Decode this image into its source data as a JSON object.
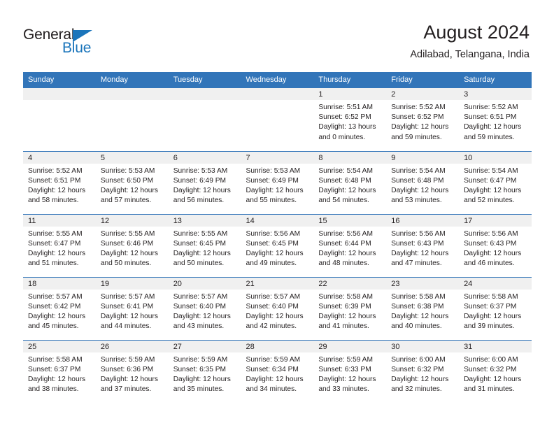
{
  "logo": {
    "text_top": "General",
    "text_bottom": "Blue",
    "accent_color": "#1b75bb"
  },
  "header": {
    "title": "August 2024",
    "subtitle": "Adilabad, Telangana, India"
  },
  "theme": {
    "header_blue": "#3275b9",
    "band_gray": "#f0f0f0",
    "text_dark": "#231f20"
  },
  "weekday_headers": [
    "Sunday",
    "Monday",
    "Tuesday",
    "Wednesday",
    "Thursday",
    "Friday",
    "Saturday"
  ],
  "weeks": [
    [
      {
        "blank": true
      },
      {
        "blank": true
      },
      {
        "blank": true
      },
      {
        "blank": true
      },
      {
        "day": "1",
        "sunrise": "Sunrise: 5:51 AM",
        "sunset": "Sunset: 6:52 PM",
        "daylight": "Daylight: 13 hours and 0 minutes."
      },
      {
        "day": "2",
        "sunrise": "Sunrise: 5:52 AM",
        "sunset": "Sunset: 6:52 PM",
        "daylight": "Daylight: 12 hours and 59 minutes."
      },
      {
        "day": "3",
        "sunrise": "Sunrise: 5:52 AM",
        "sunset": "Sunset: 6:51 PM",
        "daylight": "Daylight: 12 hours and 59 minutes."
      }
    ],
    [
      {
        "day": "4",
        "sunrise": "Sunrise: 5:52 AM",
        "sunset": "Sunset: 6:51 PM",
        "daylight": "Daylight: 12 hours and 58 minutes."
      },
      {
        "day": "5",
        "sunrise": "Sunrise: 5:53 AM",
        "sunset": "Sunset: 6:50 PM",
        "daylight": "Daylight: 12 hours and 57 minutes."
      },
      {
        "day": "6",
        "sunrise": "Sunrise: 5:53 AM",
        "sunset": "Sunset: 6:49 PM",
        "daylight": "Daylight: 12 hours and 56 minutes."
      },
      {
        "day": "7",
        "sunrise": "Sunrise: 5:53 AM",
        "sunset": "Sunset: 6:49 PM",
        "daylight": "Daylight: 12 hours and 55 minutes."
      },
      {
        "day": "8",
        "sunrise": "Sunrise: 5:54 AM",
        "sunset": "Sunset: 6:48 PM",
        "daylight": "Daylight: 12 hours and 54 minutes."
      },
      {
        "day": "9",
        "sunrise": "Sunrise: 5:54 AM",
        "sunset": "Sunset: 6:48 PM",
        "daylight": "Daylight: 12 hours and 53 minutes."
      },
      {
        "day": "10",
        "sunrise": "Sunrise: 5:54 AM",
        "sunset": "Sunset: 6:47 PM",
        "daylight": "Daylight: 12 hours and 52 minutes."
      }
    ],
    [
      {
        "day": "11",
        "sunrise": "Sunrise: 5:55 AM",
        "sunset": "Sunset: 6:47 PM",
        "daylight": "Daylight: 12 hours and 51 minutes."
      },
      {
        "day": "12",
        "sunrise": "Sunrise: 5:55 AM",
        "sunset": "Sunset: 6:46 PM",
        "daylight": "Daylight: 12 hours and 50 minutes."
      },
      {
        "day": "13",
        "sunrise": "Sunrise: 5:55 AM",
        "sunset": "Sunset: 6:45 PM",
        "daylight": "Daylight: 12 hours and 50 minutes."
      },
      {
        "day": "14",
        "sunrise": "Sunrise: 5:56 AM",
        "sunset": "Sunset: 6:45 PM",
        "daylight": "Daylight: 12 hours and 49 minutes."
      },
      {
        "day": "15",
        "sunrise": "Sunrise: 5:56 AM",
        "sunset": "Sunset: 6:44 PM",
        "daylight": "Daylight: 12 hours and 48 minutes."
      },
      {
        "day": "16",
        "sunrise": "Sunrise: 5:56 AM",
        "sunset": "Sunset: 6:43 PM",
        "daylight": "Daylight: 12 hours and 47 minutes."
      },
      {
        "day": "17",
        "sunrise": "Sunrise: 5:56 AM",
        "sunset": "Sunset: 6:43 PM",
        "daylight": "Daylight: 12 hours and 46 minutes."
      }
    ],
    [
      {
        "day": "18",
        "sunrise": "Sunrise: 5:57 AM",
        "sunset": "Sunset: 6:42 PM",
        "daylight": "Daylight: 12 hours and 45 minutes."
      },
      {
        "day": "19",
        "sunrise": "Sunrise: 5:57 AM",
        "sunset": "Sunset: 6:41 PM",
        "daylight": "Daylight: 12 hours and 44 minutes."
      },
      {
        "day": "20",
        "sunrise": "Sunrise: 5:57 AM",
        "sunset": "Sunset: 6:40 PM",
        "daylight": "Daylight: 12 hours and 43 minutes."
      },
      {
        "day": "21",
        "sunrise": "Sunrise: 5:57 AM",
        "sunset": "Sunset: 6:40 PM",
        "daylight": "Daylight: 12 hours and 42 minutes."
      },
      {
        "day": "22",
        "sunrise": "Sunrise: 5:58 AM",
        "sunset": "Sunset: 6:39 PM",
        "daylight": "Daylight: 12 hours and 41 minutes."
      },
      {
        "day": "23",
        "sunrise": "Sunrise: 5:58 AM",
        "sunset": "Sunset: 6:38 PM",
        "daylight": "Daylight: 12 hours and 40 minutes."
      },
      {
        "day": "24",
        "sunrise": "Sunrise: 5:58 AM",
        "sunset": "Sunset: 6:37 PM",
        "daylight": "Daylight: 12 hours and 39 minutes."
      }
    ],
    [
      {
        "day": "25",
        "sunrise": "Sunrise: 5:58 AM",
        "sunset": "Sunset: 6:37 PM",
        "daylight": "Daylight: 12 hours and 38 minutes."
      },
      {
        "day": "26",
        "sunrise": "Sunrise: 5:59 AM",
        "sunset": "Sunset: 6:36 PM",
        "daylight": "Daylight: 12 hours and 37 minutes."
      },
      {
        "day": "27",
        "sunrise": "Sunrise: 5:59 AM",
        "sunset": "Sunset: 6:35 PM",
        "daylight": "Daylight: 12 hours and 35 minutes."
      },
      {
        "day": "28",
        "sunrise": "Sunrise: 5:59 AM",
        "sunset": "Sunset: 6:34 PM",
        "daylight": "Daylight: 12 hours and 34 minutes."
      },
      {
        "day": "29",
        "sunrise": "Sunrise: 5:59 AM",
        "sunset": "Sunset: 6:33 PM",
        "daylight": "Daylight: 12 hours and 33 minutes."
      },
      {
        "day": "30",
        "sunrise": "Sunrise: 6:00 AM",
        "sunset": "Sunset: 6:32 PM",
        "daylight": "Daylight: 12 hours and 32 minutes."
      },
      {
        "day": "31",
        "sunrise": "Sunrise: 6:00 AM",
        "sunset": "Sunset: 6:32 PM",
        "daylight": "Daylight: 12 hours and 31 minutes."
      }
    ]
  ]
}
